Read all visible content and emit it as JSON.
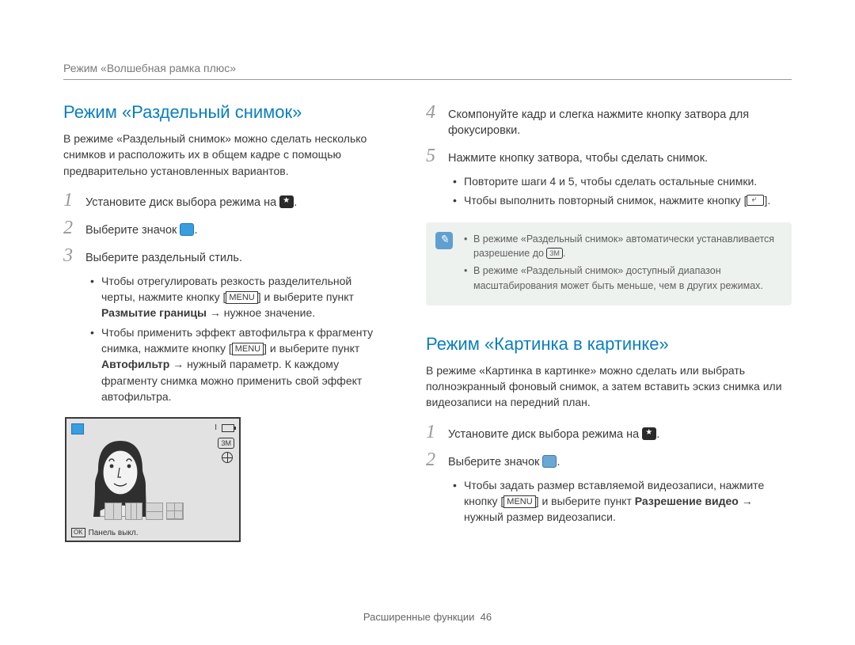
{
  "breadcrumb": "Режим «Волшебная рамка плюс»",
  "left": {
    "title": "Режим «Раздельный снимок»",
    "intro": "В режиме «Раздельный снимок» можно сделать несколько снимков и расположить их в общем кадре с помощью предварительно установленных вариантов.",
    "step1": "Установите диск выбора режима на",
    "step2": "Выберите значок",
    "step3": "Выберите раздельный стиль.",
    "sub3a_1": "Чтобы отрегулировать резкость разделительной черты, нажмите кнопку [",
    "sub3a_menu": "MENU",
    "sub3a_2": "] и выберите пункт ",
    "sub3a_bold": "Размытие границы",
    "sub3a_3": " → нужное значение.",
    "sub3b_1": "Чтобы применить эффект автофильтра к фрагменту снимка, нажмите кнопку [",
    "sub3b_2": "] и выберите пункт ",
    "sub3b_bold": "Автофильтр",
    "sub3b_3": " → нужный параметр. К каждому фрагменту снимка можно применить свой эффект автофильтра.",
    "panel_off": "Панель выкл.",
    "ok": "OK",
    "threeM": "3M"
  },
  "right": {
    "step4": "Скомпонуйте кадр и слегка нажмите кнопку затвора для фокусировки.",
    "step5": "Нажмите кнопку затвора, чтобы сделать снимок.",
    "sub5a": "Повторите шаги 4 и 5, чтобы сделать остальные снимки.",
    "sub5b_1": "Чтобы выполнить повторный снимок, нажмите кнопку [",
    "sub5b_2": "].",
    "note1_1": "В режиме «Раздельный снимок» автоматически устанавливается разрешение до ",
    "note1_3m": "3M",
    "note1_2": ".",
    "note2": "В режиме «Раздельный снимок» доступный диапазон масштабирования может быть меньше, чем в других режимах.",
    "title2": "Режим «Картинка в картинке»",
    "intro2": "В режиме «Картинка в картинке» можно сделать или выбрать полноэкранный фоновый снимок, а затем вставить эскиз снимка или видеозаписи на передний план.",
    "pstep1": "Установите диск выбора режима на",
    "pstep2": "Выберите значок",
    "psub_1": "Чтобы задать размер вставляемой видеозаписи, нажмите кнопку [",
    "psub_menu": "MENU",
    "psub_2": "] и выберите пункт ",
    "psub_bold": "Разрешение видео",
    "psub_3": " → нужный размер видеозаписи."
  },
  "footer": {
    "section": "Расширенные функции",
    "page": "46"
  }
}
